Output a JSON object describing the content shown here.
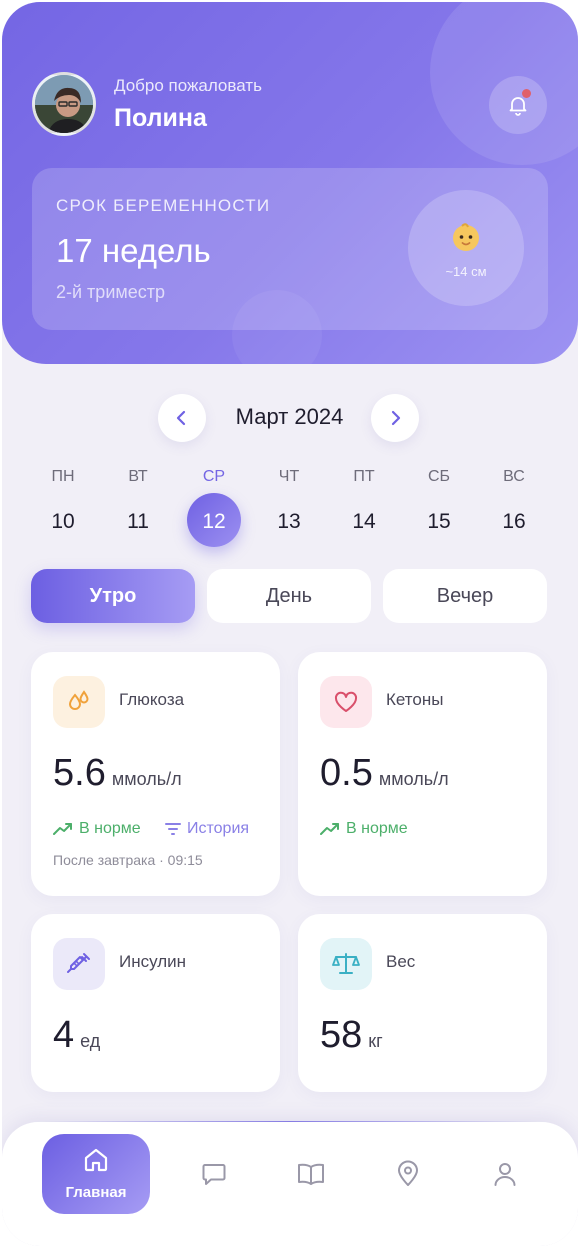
{
  "header": {
    "welcome": "Добро пожаловать",
    "username": "Полина",
    "notifications_icon": "bell-icon"
  },
  "pregnancy": {
    "label": "СРОК БЕРЕМЕННОСТИ",
    "weeks": "17 недель",
    "trimester": "2-й триместр",
    "baby_size": "~14 см"
  },
  "calendar": {
    "month": "Март 2024",
    "days": [
      {
        "name": "ПН",
        "num": "10"
      },
      {
        "name": "ВТ",
        "num": "11"
      },
      {
        "name": "СР",
        "num": "12",
        "selected": true
      },
      {
        "name": "ЧТ",
        "num": "13"
      },
      {
        "name": "ПТ",
        "num": "14"
      },
      {
        "name": "СБ",
        "num": "15"
      },
      {
        "name": "ВС",
        "num": "16"
      }
    ]
  },
  "segments": [
    {
      "label": "Утро",
      "active": true
    },
    {
      "label": "День"
    },
    {
      "label": "Вечер"
    }
  ],
  "metrics": {
    "glucose": {
      "title": "Глюкоза",
      "value": "5.6",
      "unit": "ммоль/л",
      "status": "В норме",
      "history": "История",
      "note": "После завтрака · 09:15",
      "icon": "drops-icon"
    },
    "ketones": {
      "title": "Кетоны",
      "value": "0.5",
      "unit": "ммоль/л",
      "status": "В норме",
      "icon": "heart-icon"
    },
    "insulin": {
      "title": "Инсулин",
      "value": "4",
      "unit": "ед",
      "icon": "syringe-icon"
    },
    "weight": {
      "title": "Вес",
      "value": "58",
      "unit": "кг",
      "icon": "scale-icon"
    }
  },
  "bottom_nav": {
    "items": [
      {
        "label": "Главная",
        "icon": "home-icon",
        "active": true
      },
      {
        "icon": "chat-icon"
      },
      {
        "icon": "book-icon"
      },
      {
        "icon": "map-pin-icon"
      },
      {
        "icon": "profile-icon"
      }
    ]
  },
  "colors": {
    "accent": "#7466e4",
    "success": "#4caf6a",
    "background": "#f1eff7"
  }
}
